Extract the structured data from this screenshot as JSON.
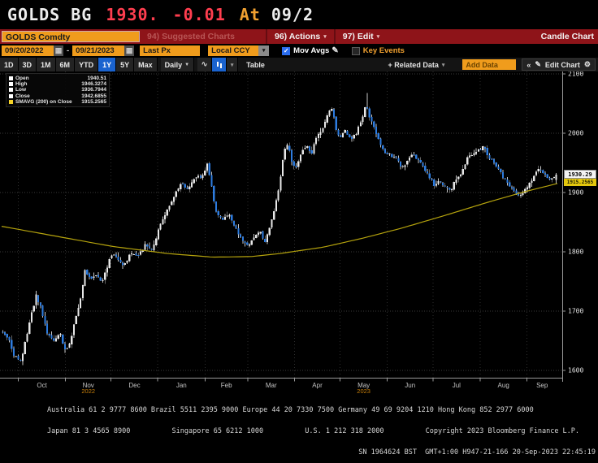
{
  "title_bar": {
    "ticker": "GOLDS BG",
    "price": "1930.",
    "change": "-0.01",
    "at_label": "At",
    "date": "09/2"
  },
  "menu_bar": {
    "security": "GOLDS Comdty",
    "suggested": "94) Suggested Charts",
    "actions": "96) Actions",
    "edit": "97) Edit",
    "right_label": "Candle Chart"
  },
  "settings_bar": {
    "start_date": "09/20/2022",
    "range_separator": "-",
    "end_date": "09/21/2023",
    "price_field": "Last Px",
    "currency": "Local CCY",
    "mov_avgs_label": "Mov Avgs",
    "key_events_label": "Key Events"
  },
  "toolbar": {
    "ranges": [
      "1D",
      "3D",
      "1M",
      "6M",
      "YTD",
      "1Y",
      "5Y",
      "Max"
    ],
    "active_range": "1Y",
    "period_label": "Daily",
    "table_label": "Table",
    "related_data_label": "+ Related Data",
    "add_data_placeholder": "Add Data",
    "edit_chart_label": "Edit Chart"
  },
  "icons": {
    "calendar": "▦",
    "caret_down": "▾",
    "caret_solid": "▼",
    "check": "✓",
    "pencil": "✎",
    "gear": "⚙",
    "collapse": "«",
    "line_chart": "∿"
  },
  "legend": {
    "items": [
      {
        "label": "Open",
        "value": "1940.51",
        "color": "#ffffff"
      },
      {
        "label": "High",
        "value": "1946.3274",
        "color": "#ffffff"
      },
      {
        "label": "Low",
        "value": "1936.7944",
        "color": "#ffffff"
      },
      {
        "label": "Close",
        "value": "1942.6855",
        "color": "#ffffff"
      },
      {
        "label": "SMAVG (200)  on Close",
        "value": "1915.2565",
        "color": "#f5d327"
      }
    ]
  },
  "axis": {
    "last_price_label": "1930.29",
    "smavg_label": "1915.2565"
  },
  "footer": {
    "line1": "Australia 61 2 9777 8600 Brazil 5511 2395 9000 Europe 44 20 7330 7500 Germany 49 69 9204 1210 Hong Kong 852 2977 6000",
    "line2": "Japan 81 3 4565 8900          Singapore 65 6212 1000          U.S. 1 212 318 2000          Copyright 2023 Bloomberg Finance L.P.",
    "line3": "SN 1964624 BST  GMT+1:00 H947-21-166 20-Sep-2023 22:45:19"
  },
  "chart_data": {
    "type": "candlestick",
    "title": "GOLDS Comdty — Candle Chart, Daily, 1Y",
    "period": "Daily",
    "x_range": [
      "09/20/2022",
      "09/21/2023"
    ],
    "last_price": 1930.29,
    "smavg_last": 1915.2565,
    "n_candles": 250,
    "y_axis": {
      "ticks": [
        2100,
        2000,
        1900,
        1800,
        1700,
        1600
      ]
    },
    "x_axis": {
      "month_labels": [
        "Oct",
        "Nov",
        "Dec",
        "Jan",
        "Feb",
        "Mar",
        "Apr",
        "May",
        "Jun",
        "Jul",
        "Aug",
        "Sep"
      ],
      "month_boundaries_t": [
        0.03,
        0.115,
        0.197,
        0.281,
        0.366,
        0.443,
        0.527,
        0.609,
        0.694,
        0.776,
        0.861,
        0.945
      ],
      "year_labels": [
        {
          "text": "2022",
          "month_index": 1
        },
        {
          "text": "2023",
          "month_index": 7
        }
      ]
    },
    "close_anchors": [
      [
        0,
        1665
      ],
      [
        0.012,
        1655
      ],
      [
        0.02,
        1628
      ],
      [
        0.035,
        1615
      ],
      [
        0.045,
        1660
      ],
      [
        0.055,
        1700
      ],
      [
        0.062,
        1726
      ],
      [
        0.072,
        1702
      ],
      [
        0.082,
        1662
      ],
      [
        0.095,
        1648
      ],
      [
        0.105,
        1662
      ],
      [
        0.115,
        1632
      ],
      [
        0.122,
        1644
      ],
      [
        0.13,
        1676
      ],
      [
        0.14,
        1712
      ],
      [
        0.15,
        1768
      ],
      [
        0.16,
        1754
      ],
      [
        0.17,
        1762
      ],
      [
        0.18,
        1748
      ],
      [
        0.192,
        1781
      ],
      [
        0.2,
        1800
      ],
      [
        0.21,
        1784
      ],
      [
        0.22,
        1778
      ],
      [
        0.232,
        1797
      ],
      [
        0.245,
        1792
      ],
      [
        0.258,
        1812
      ],
      [
        0.27,
        1803
      ],
      [
        0.282,
        1836
      ],
      [
        0.295,
        1865
      ],
      [
        0.31,
        1892
      ],
      [
        0.322,
        1917
      ],
      [
        0.335,
        1906
      ],
      [
        0.348,
        1928
      ],
      [
        0.36,
        1926
      ],
      [
        0.37,
        1949
      ],
      [
        0.378,
        1912
      ],
      [
        0.385,
        1867
      ],
      [
        0.398,
        1856
      ],
      [
        0.41,
        1862
      ],
      [
        0.422,
        1838
      ],
      [
        0.435,
        1818
      ],
      [
        0.443,
        1811
      ],
      [
        0.455,
        1823
      ],
      [
        0.465,
        1838
      ],
      [
        0.472,
        1814
      ],
      [
        0.48,
        1832
      ],
      [
        0.49,
        1870
      ],
      [
        0.5,
        1912
      ],
      [
        0.508,
        1972
      ],
      [
        0.515,
        1984
      ],
      [
        0.522,
        1952
      ],
      [
        0.53,
        1943
      ],
      [
        0.54,
        1968
      ],
      [
        0.55,
        1978
      ],
      [
        0.558,
        1967
      ],
      [
        0.568,
        1998
      ],
      [
        0.578,
        2008
      ],
      [
        0.588,
        2036
      ],
      [
        0.595,
        2044
      ],
      [
        0.602,
        2004
      ],
      [
        0.61,
        1992
      ],
      [
        0.618,
        2005
      ],
      [
        0.628,
        1988
      ],
      [
        0.638,
        2000
      ],
      [
        0.648,
        2022
      ],
      [
        0.655,
        2048
      ],
      [
        0.662,
        2028
      ],
      [
        0.67,
        2012
      ],
      [
        0.68,
        1983
      ],
      [
        0.69,
        1968
      ],
      [
        0.7,
        1962
      ],
      [
        0.71,
        1957
      ],
      [
        0.72,
        1943
      ],
      [
        0.728,
        1948
      ],
      [
        0.738,
        1963
      ],
      [
        0.748,
        1958
      ],
      [
        0.758,
        1943
      ],
      [
        0.768,
        1928
      ],
      [
        0.778,
        1913
      ],
      [
        0.788,
        1921
      ],
      [
        0.798,
        1908
      ],
      [
        0.808,
        1903
      ],
      [
        0.818,
        1923
      ],
      [
        0.828,
        1933
      ],
      [
        0.838,
        1958
      ],
      [
        0.848,
        1963
      ],
      [
        0.858,
        1972
      ],
      [
        0.868,
        1977
      ],
      [
        0.878,
        1958
      ],
      [
        0.888,
        1949
      ],
      [
        0.898,
        1933
      ],
      [
        0.908,
        1918
      ],
      [
        0.918,
        1908
      ],
      [
        0.928,
        1893
      ],
      [
        0.938,
        1899
      ],
      [
        0.948,
        1913
      ],
      [
        0.958,
        1926
      ],
      [
        0.965,
        1940
      ],
      [
        0.975,
        1933
      ],
      [
        0.985,
        1921
      ],
      [
        1,
        1930.29
      ]
    ],
    "smavg_anchors": [
      [
        0,
        1843
      ],
      [
        0.1,
        1826
      ],
      [
        0.2,
        1809
      ],
      [
        0.3,
        1797
      ],
      [
        0.38,
        1791
      ],
      [
        0.45,
        1792
      ],
      [
        0.5,
        1797
      ],
      [
        0.58,
        1808
      ],
      [
        0.65,
        1823
      ],
      [
        0.72,
        1840
      ],
      [
        0.8,
        1862
      ],
      [
        0.88,
        1885
      ],
      [
        0.94,
        1901
      ],
      [
        1,
        1915.26
      ]
    ],
    "colors": {
      "up": "#e8e8e8",
      "down": "#2d7ce0",
      "wick": "#c6c6c6",
      "smavg": "#b5a30d",
      "grid_h": "#3a3a3a",
      "grid_v": "#2e2e2e",
      "axis": "#9a9a9a",
      "tick_text": "#e2e2e2",
      "month_text": "#c4c4c4",
      "year_text": "#c87f0a"
    }
  }
}
